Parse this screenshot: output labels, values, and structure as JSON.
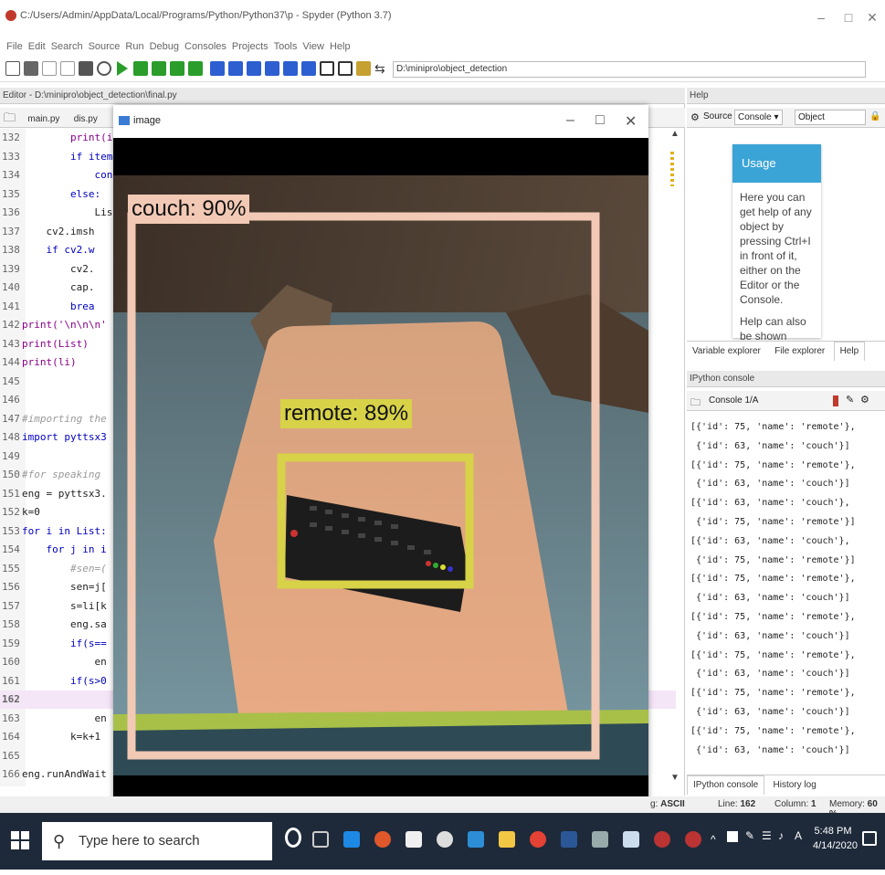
{
  "window": {
    "title": "C:/Users/Admin/AppData/Local/Programs/Python/Python37\\p - Spyder (Python 3.7)"
  },
  "menubar": {
    "items": [
      "File",
      "Edit",
      "Search",
      "Source",
      "Run",
      "Debug",
      "Consoles",
      "Projects",
      "Tools",
      "View",
      "Help"
    ]
  },
  "toolbar": {
    "path": "D:\\minipro\\object_detection"
  },
  "editor": {
    "header": "Editor - D:\\minipro\\object_detection\\final.py",
    "tabs": [
      "main.py",
      "dis.py"
    ],
    "lines": [
      {
        "n": "132",
        "code": "        print(it"
      },
      {
        "n": "133",
        "code": "        if item"
      },
      {
        "n": "134",
        "code": "            cont"
      },
      {
        "n": "135",
        "code": "        else:"
      },
      {
        "n": "136",
        "code": "            List"
      },
      {
        "n": "137",
        "code": "    cv2.imsh"
      },
      {
        "n": "138",
        "code": "    if cv2.w"
      },
      {
        "n": "139",
        "code": "        cv2."
      },
      {
        "n": "140",
        "code": "        cap."
      },
      {
        "n": "141",
        "code": "        brea"
      },
      {
        "n": "142",
        "code": "print('\\n\\n\\n'"
      },
      {
        "n": "143",
        "code": "print(List)"
      },
      {
        "n": "144",
        "code": "print(li)"
      },
      {
        "n": "145",
        "code": ""
      },
      {
        "n": "146",
        "code": ""
      },
      {
        "n": "147",
        "code": "#importing the"
      },
      {
        "n": "148",
        "code": "import pyttsx3"
      },
      {
        "n": "149",
        "code": ""
      },
      {
        "n": "150",
        "code": "#for speaking"
      },
      {
        "n": "151",
        "code": "eng = pyttsx3."
      },
      {
        "n": "152",
        "code": "k=0"
      },
      {
        "n": "153",
        "code": "for i in List:"
      },
      {
        "n": "154",
        "code": "    for j in i"
      },
      {
        "n": "155",
        "code": "        #sen=("
      },
      {
        "n": "156",
        "code": "        sen=j["
      },
      {
        "n": "157",
        "code": "        s=li[k"
      },
      {
        "n": "158",
        "code": "        eng.sa"
      },
      {
        "n": "159",
        "code": "        if(s=="
      },
      {
        "n": "160",
        "code": "            en"
      },
      {
        "n": "161",
        "code": "        if(s>0"
      },
      {
        "n": "162",
        "code": ""
      },
      {
        "n": "163",
        "code": "            en"
      },
      {
        "n": "164",
        "code": "        k=k+1"
      },
      {
        "n": "165",
        "code": ""
      },
      {
        "n": "166",
        "code": "eng.runAndWait"
      }
    ]
  },
  "detection_window": {
    "title": "image",
    "detections": [
      {
        "label": "couch: 90%"
      },
      {
        "label": "remote: 89%"
      }
    ]
  },
  "help": {
    "header": "Help",
    "source_label": "Source",
    "source_value": "Console",
    "object_label": "Object",
    "usage_title": "Usage",
    "usage_text_1": "Here you can get help of any object by pressing Ctrl+I in front of it, either on the Editor or the Console.",
    "usage_text_2": "Help can also be shown",
    "tabs": [
      "Variable explorer",
      "File explorer",
      "Help"
    ]
  },
  "console": {
    "header": "IPython console",
    "tab": "Console 1/A",
    "lines": [
      "[{'id': 75, 'name': 'remote'},",
      " {'id': 63, 'name': 'couch'}]",
      "[{'id': 75, 'name': 'remote'},",
      " {'id': 63, 'name': 'couch'}]",
      "[{'id': 63, 'name': 'couch'},",
      " {'id': 75, 'name': 'remote'}]",
      "[{'id': 63, 'name': 'couch'},",
      " {'id': 75, 'name': 'remote'}]",
      "[{'id': 75, 'name': 'remote'},",
      " {'id': 63, 'name': 'couch'}]",
      "[{'id': 75, 'name': 'remote'},",
      " {'id': 63, 'name': 'couch'}]",
      "[{'id': 75, 'name': 'remote'},",
      " {'id': 63, 'name': 'couch'}]",
      "[{'id': 75, 'name': 'remote'},",
      " {'id': 63, 'name': 'couch'}]",
      "[{'id': 75, 'name': 'remote'},",
      " {'id': 63, 'name': 'couch'}]"
    ],
    "bottom_tabs": [
      "IPython console",
      "History log"
    ]
  },
  "status": {
    "encoding": "ASCII",
    "line": "162",
    "column": "1",
    "memory": "60 %"
  },
  "taskbar": {
    "search_placeholder": "Type here to search",
    "time": "5:48 PM",
    "date": "4/14/2020"
  }
}
